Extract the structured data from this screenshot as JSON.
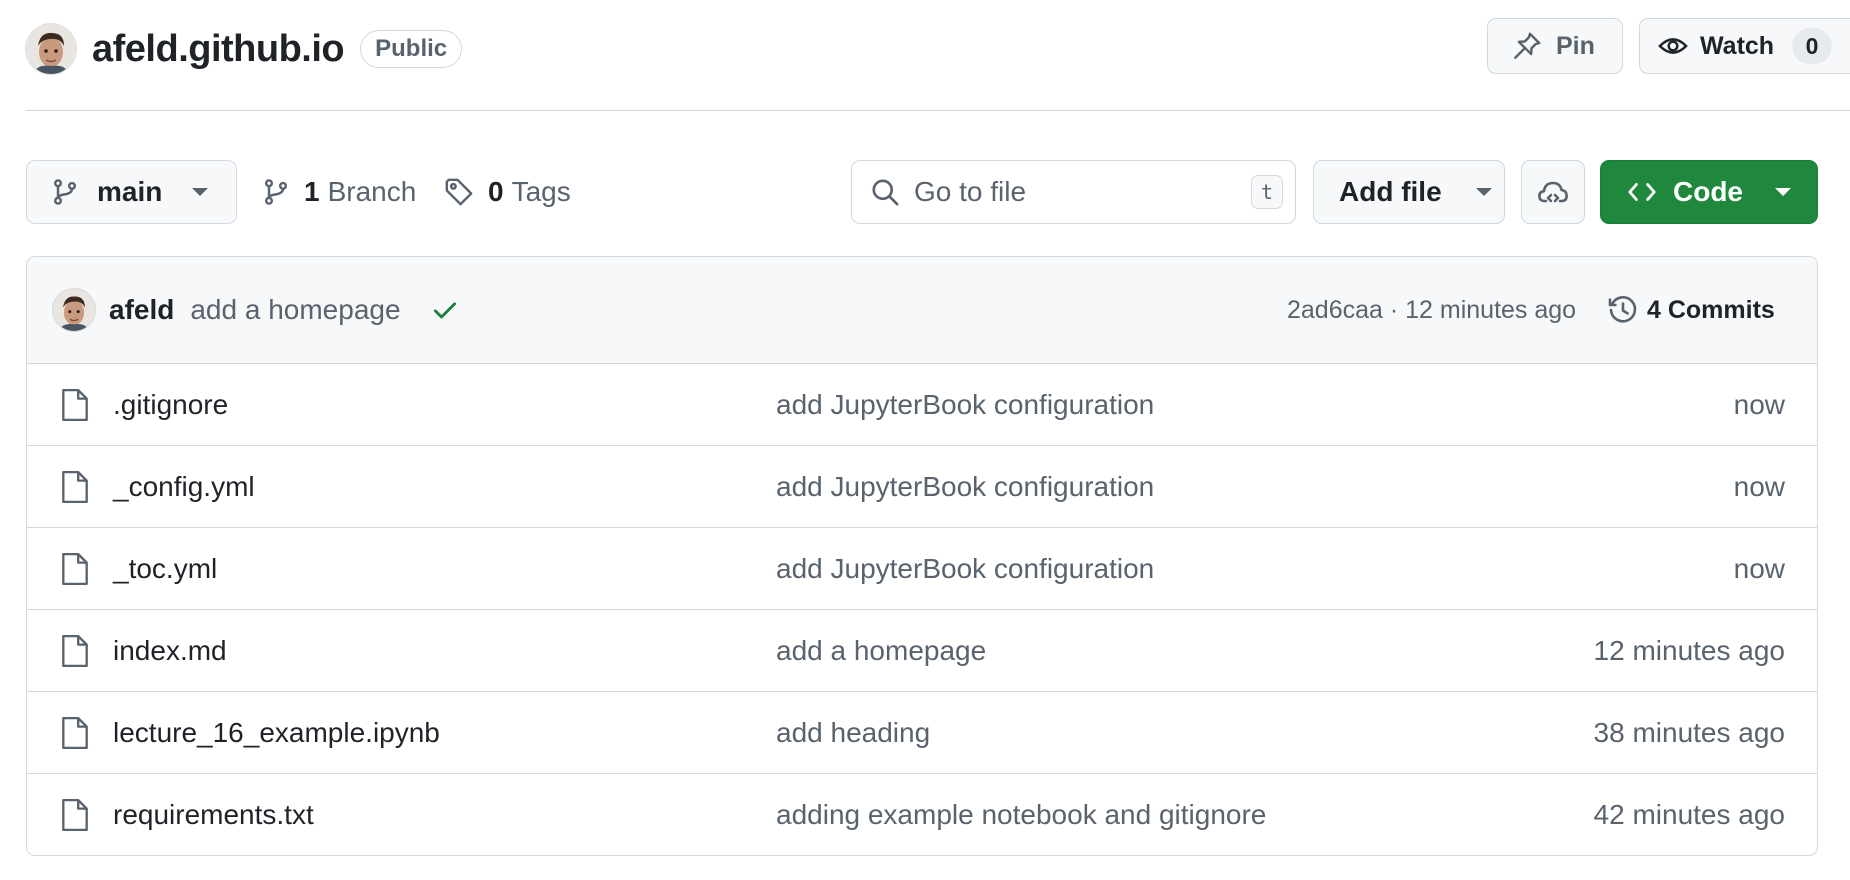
{
  "repo": {
    "name": "afeld.github.io",
    "visibility": "Public",
    "pin_label": "Pin",
    "watch_label": "Watch",
    "watch_count": "0"
  },
  "toolbar": {
    "branch": "main",
    "branch_count": "1",
    "branch_suffix": "Branch",
    "tag_count": "0",
    "tag_suffix": "Tags",
    "search_placeholder": "Go to file",
    "search_shortcut": "t",
    "add_file_label": "Add file",
    "code_label": "Code"
  },
  "latest_commit": {
    "author": "afeld",
    "message": "add a homepage",
    "meta": "2ad6caa · 12 minutes ago",
    "commits_label": "4 Commits"
  },
  "files": [
    {
      "name": ".gitignore",
      "commit": "add JupyterBook configuration",
      "age": "now"
    },
    {
      "name": "_config.yml",
      "commit": "add JupyterBook configuration",
      "age": "now"
    },
    {
      "name": "_toc.yml",
      "commit": "add JupyterBook configuration",
      "age": "now"
    },
    {
      "name": "index.md",
      "commit": "add a homepage",
      "age": "12 minutes ago"
    },
    {
      "name": "lecture_16_example.ipynb",
      "commit": "add heading",
      "age": "38 minutes ago"
    },
    {
      "name": "requirements.txt",
      "commit": "adding example notebook and gitignore",
      "age": "42 minutes ago"
    }
  ],
  "icons": {
    "pin": "pin-icon",
    "watch": "eye-icon",
    "branch": "git-branch-icon",
    "tag": "tag-icon",
    "search": "search-icon",
    "cloud": "cloud-icon",
    "code": "code-icon",
    "check": "check-icon",
    "history": "history-icon",
    "file": "file-icon"
  },
  "colors": {
    "primary_button": "#1f883d",
    "border": "#d1d9e0",
    "muted_text": "#59636e",
    "check": "#1a7f37"
  }
}
